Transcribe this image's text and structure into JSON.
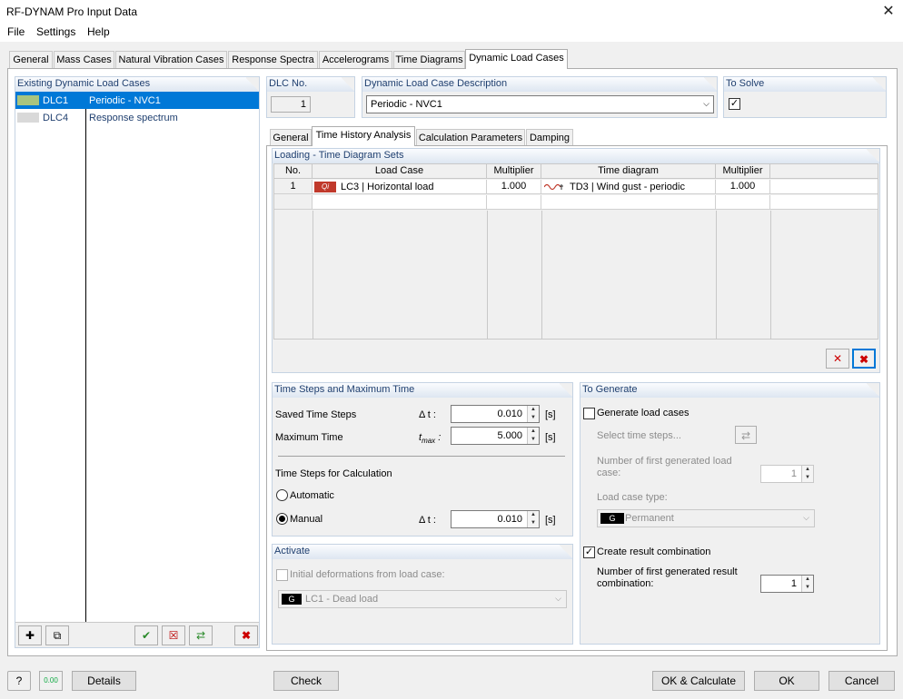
{
  "window": {
    "title": "RF-DYNAM Pro Input Data"
  },
  "menu": [
    "File",
    "Settings",
    "Help"
  ],
  "tabs": [
    "General",
    "Mass Cases",
    "Natural Vibration Cases",
    "Response Spectra",
    "Accelerograms",
    "Time Diagrams",
    "Dynamic Load Cases"
  ],
  "left": {
    "title": "Existing Dynamic Load Cases",
    "items": [
      {
        "id": "DLC1",
        "name": "Periodic - NVC1",
        "color": "#a9c47f"
      },
      {
        "id": "DLC4",
        "name": "Response spectrum",
        "color": "#d9d9d9"
      }
    ]
  },
  "dlc": {
    "label": "DLC No.",
    "value": "1"
  },
  "desc": {
    "label": "Dynamic Load Case Description",
    "value": "Periodic - NVC1"
  },
  "solve": {
    "label": "To Solve",
    "checked": "☑"
  },
  "subtabs": [
    "General",
    "Time History Analysis",
    "Calculation Parameters",
    "Damping"
  ],
  "loading": {
    "title": "Loading - Time Diagram Sets",
    "headers": [
      "No.",
      "Load Case",
      "Multiplier",
      "Time diagram",
      "Multiplier"
    ],
    "rows": [
      {
        "no": "1",
        "badge": "Qi",
        "lc": "LC3 | Horizontal load",
        "m1": "1.000",
        "td": "TD3 | Wind gust - periodic",
        "m2": "1.000"
      }
    ]
  },
  "timesteps": {
    "title": "Time Steps and Maximum Time",
    "saved_label": "Saved Time Steps",
    "saved_sym": "Δ t :",
    "saved_value": "0.010",
    "saved_unit": "[s]",
    "max_label": "Maximum Time",
    "max_sym": "t",
    "max_sub": "max",
    "max_colon": " :",
    "max_value": "5.000",
    "max_unit": "[s]",
    "calc_label": "Time Steps for Calculation",
    "auto_label": "Automatic",
    "manual_label": "Manual",
    "manual_sym": "Δ t :",
    "manual_value": "0.010",
    "manual_unit": "[s]"
  },
  "activate": {
    "title": "Activate",
    "init_label": "Initial deformations from load case:",
    "badge": "G",
    "lc": "LC1 - Dead load"
  },
  "generate": {
    "title": "To Generate",
    "gen_lc_label": "Generate load cases",
    "select_steps": "Select time steps...",
    "first_lc_label": "Number of first generated load case:",
    "first_lc_value": "1",
    "lc_type_label": "Load case type:",
    "lc_type_badge": "G",
    "lc_type_value": "Permanent",
    "result_combo_label": "Create result combination",
    "first_rc_label": "Number of first generated result combination:",
    "first_rc_value": "1"
  },
  "footer": {
    "details": "Details",
    "check": "Check",
    "ok_calc": "OK & Calculate",
    "ok": "OK",
    "cancel": "Cancel",
    "calc_icon_text": "0.00"
  }
}
